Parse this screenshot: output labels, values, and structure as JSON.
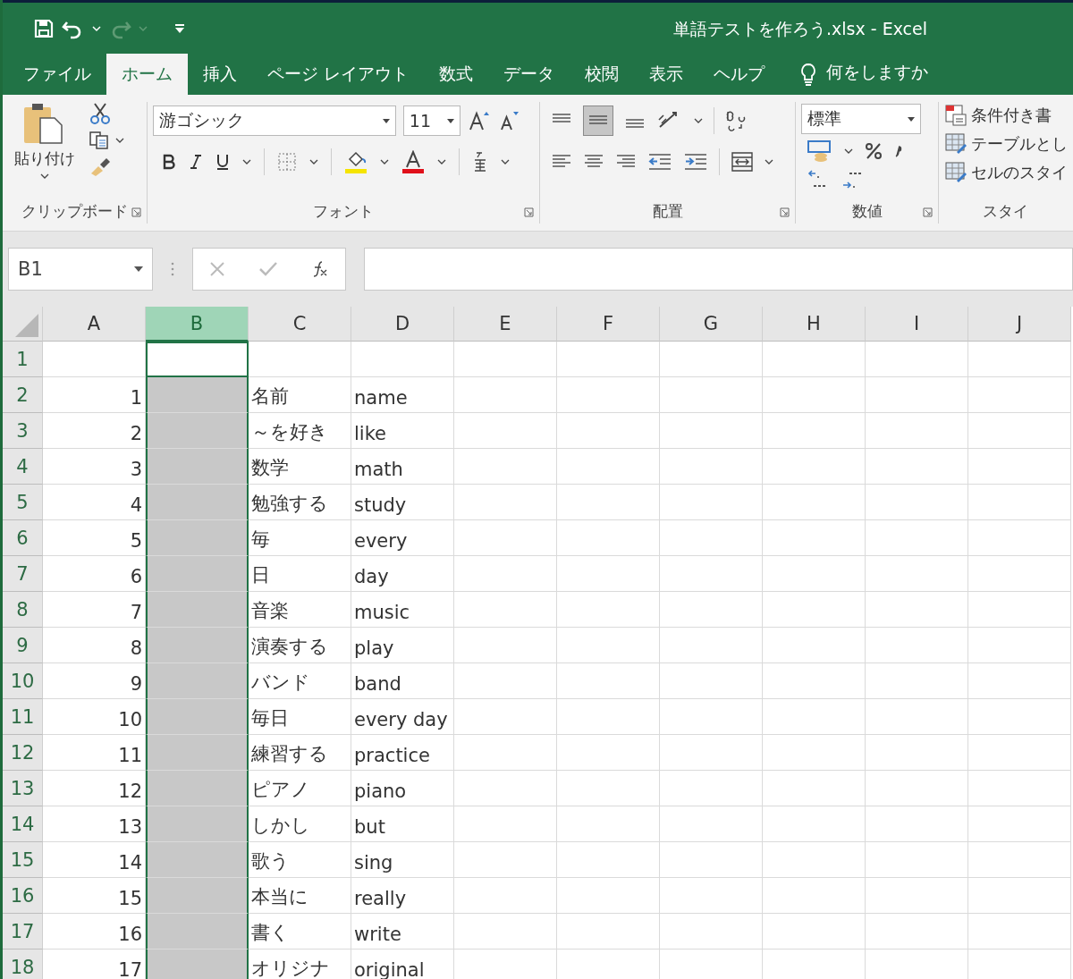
{
  "window": {
    "title": "単語テストを作ろう.xlsx  -  Excel"
  },
  "tabs": [
    {
      "label": "ファイル",
      "selected": false
    },
    {
      "label": "ホーム",
      "selected": true
    },
    {
      "label": "挿入",
      "selected": false
    },
    {
      "label": "ページ レイアウト",
      "selected": false
    },
    {
      "label": "数式",
      "selected": false
    },
    {
      "label": "データ",
      "selected": false
    },
    {
      "label": "校閲",
      "selected": false
    },
    {
      "label": "表示",
      "selected": false
    },
    {
      "label": "ヘルプ",
      "selected": false
    }
  ],
  "tell_me": {
    "placeholder": "何をしますか"
  },
  "ribbon": {
    "clipboard": {
      "label": "クリップボード",
      "paste": "貼り付け"
    },
    "font": {
      "label": "フォント",
      "font_name": "游ゴシック",
      "font_size": "11"
    },
    "alignment": {
      "label": "配置"
    },
    "number": {
      "label": "数値",
      "format": "標準"
    },
    "styles": {
      "label": "スタイ",
      "items": [
        "条件付き書",
        "テーブルとし",
        "セルのスタイ"
      ]
    }
  },
  "name_box": {
    "value": "B1"
  },
  "columns": [
    {
      "label": "A",
      "selected": false
    },
    {
      "label": "B",
      "selected": true
    },
    {
      "label": "C",
      "selected": false
    },
    {
      "label": "D",
      "selected": false
    },
    {
      "label": "E",
      "selected": false
    },
    {
      "label": "F",
      "selected": false
    },
    {
      "label": "G",
      "selected": false
    },
    {
      "label": "H",
      "selected": false
    },
    {
      "label": "I",
      "selected": false
    },
    {
      "label": "J",
      "selected": false
    }
  ],
  "rows": [
    {
      "number": "1",
      "a": "",
      "c": "",
      "d": "",
      "b_shaded": false,
      "b_active": true
    },
    {
      "number": "2",
      "a": "1",
      "c": "名前",
      "d": "name",
      "b_shaded": true,
      "b_active": false
    },
    {
      "number": "3",
      "a": "2",
      "c": "～を好き",
      "d": "like",
      "b_shaded": true,
      "b_active": false
    },
    {
      "number": "4",
      "a": "3",
      "c": "数学",
      "d": "math",
      "b_shaded": true,
      "b_active": false
    },
    {
      "number": "5",
      "a": "4",
      "c": "勉強する",
      "d": "study",
      "b_shaded": true,
      "b_active": false
    },
    {
      "number": "6",
      "a": "5",
      "c": "毎",
      "d": "every",
      "b_shaded": true,
      "b_active": false
    },
    {
      "number": "7",
      "a": "6",
      "c": "日",
      "d": "day",
      "b_shaded": true,
      "b_active": false
    },
    {
      "number": "8",
      "a": "7",
      "c": "音楽",
      "d": "music",
      "b_shaded": true,
      "b_active": false
    },
    {
      "number": "9",
      "a": "8",
      "c": "演奏する",
      "d": "play",
      "b_shaded": true,
      "b_active": false
    },
    {
      "number": "10",
      "a": "9",
      "c": "バンド",
      "d": "band",
      "b_shaded": true,
      "b_active": false
    },
    {
      "number": "11",
      "a": "10",
      "c": "毎日",
      "d": "every day",
      "b_shaded": true,
      "b_active": false
    },
    {
      "number": "12",
      "a": "11",
      "c": "練習する",
      "d": "practice",
      "b_shaded": true,
      "b_active": false
    },
    {
      "number": "13",
      "a": "12",
      "c": "ピアノ",
      "d": "piano",
      "b_shaded": true,
      "b_active": false
    },
    {
      "number": "14",
      "a": "13",
      "c": "しかし",
      "d": "but",
      "b_shaded": true,
      "b_active": false
    },
    {
      "number": "15",
      "a": "14",
      "c": "歌う",
      "d": "sing",
      "b_shaded": true,
      "b_active": false
    },
    {
      "number": "16",
      "a": "15",
      "c": "本当に",
      "d": "really",
      "b_shaded": true,
      "b_active": false
    },
    {
      "number": "17",
      "a": "16",
      "c": "書く",
      "d": "write",
      "b_shaded": true,
      "b_active": false
    },
    {
      "number": "18",
      "a": "17",
      "c": "オリジナ",
      "d": "original",
      "b_shaded": true,
      "b_active": false
    }
  ]
}
